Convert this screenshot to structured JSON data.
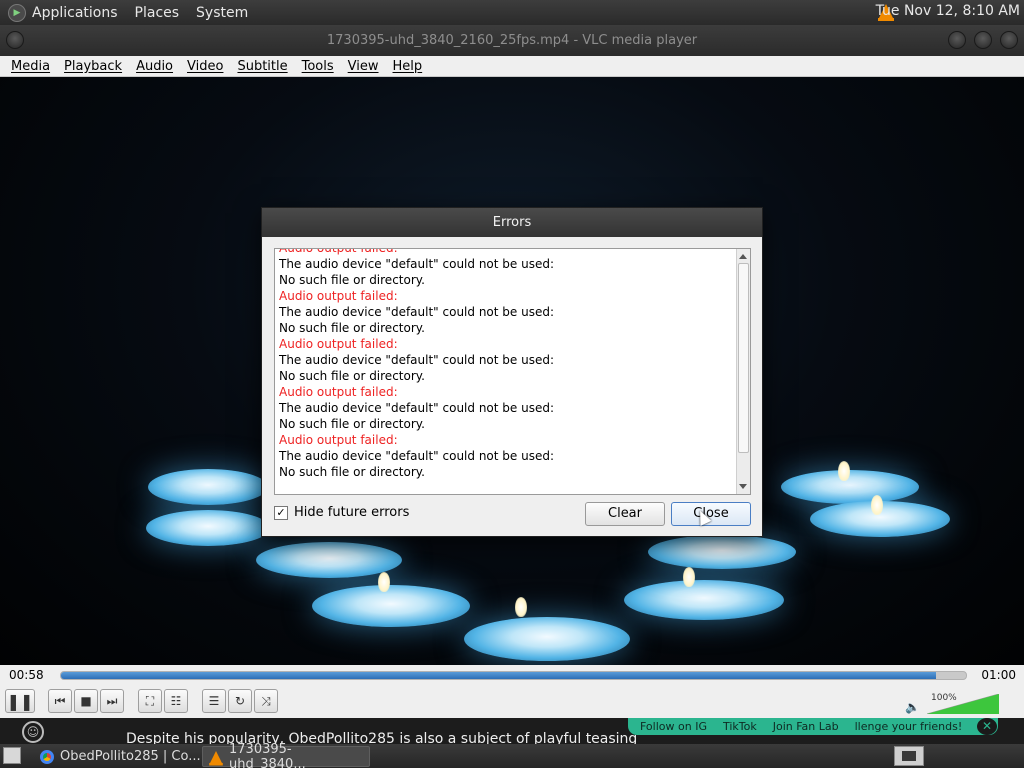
{
  "top_panel": {
    "menus": [
      "Applications",
      "Places",
      "System"
    ],
    "clock": "Tue Nov 12,  8:10 AM"
  },
  "window": {
    "title": "1730395-uhd_3840_2160_25fps.mp4 - VLC media player"
  },
  "menubar": [
    "Media",
    "Playback",
    "Audio",
    "Video",
    "Subtitle",
    "Tools",
    "View",
    "Help"
  ],
  "dialog": {
    "title": "Errors",
    "partial_top_line": "Audio output failed:",
    "entries": [
      {
        "heading": "Audio output failed:",
        "line1": "The audio device \"default\" could not be used:",
        "line2": "No such file or directory."
      },
      {
        "heading": "Audio output failed:",
        "line1": "The audio device \"default\" could not be used:",
        "line2": "No such file or directory."
      },
      {
        "heading": "Audio output failed:",
        "line1": "The audio device \"default\" could not be used:",
        "line2": "No such file or directory."
      },
      {
        "heading": "Audio output failed:",
        "line1": "The audio device \"default\" could not be used:",
        "line2": "No such file or directory."
      },
      {
        "heading": "Audio output failed:",
        "line1": "The audio device \"default\" could not be used:",
        "line2": "No such file or directory."
      }
    ],
    "hide_future_errors_label": "Hide future errors",
    "hide_future_errors_checked": true,
    "check_mark": "✓",
    "clear_label": "Clear",
    "close_label": "Close"
  },
  "player": {
    "time_elapsed": "00:58",
    "time_total": "01:00",
    "progress_fraction": 0.967,
    "volume_label": "100%",
    "volume_fraction": 1.0
  },
  "browser_overlay": {
    "caption": "Despite his popularity, ObedPollito285 is also a subject of playful teasing",
    "promo_items": [
      "Follow on IG",
      "TikTok",
      "Join Fan Lab",
      "llenge your friends!"
    ],
    "close_glyph": "✕"
  },
  "taskbar": {
    "tasks": [
      "ObedPollito285 | Co...",
      "1730395-uhd_3840..."
    ]
  },
  "colors": {
    "error_red": "#ee2222",
    "progress_blue": "#2d6fb7",
    "volume_green": "#3dc63d",
    "promo_green": "#2bb58f"
  },
  "icons": {
    "play_pause": "pause-icon",
    "prev": "skip-previous-icon",
    "stop": "stop-icon",
    "next": "skip-next-icon",
    "fullscreen": "fullscreen-icon",
    "extended": "equalizer-icon",
    "playlist": "playlist-icon",
    "loop": "loop-icon",
    "shuffle": "shuffle-icon",
    "volume": "speaker-icon"
  }
}
